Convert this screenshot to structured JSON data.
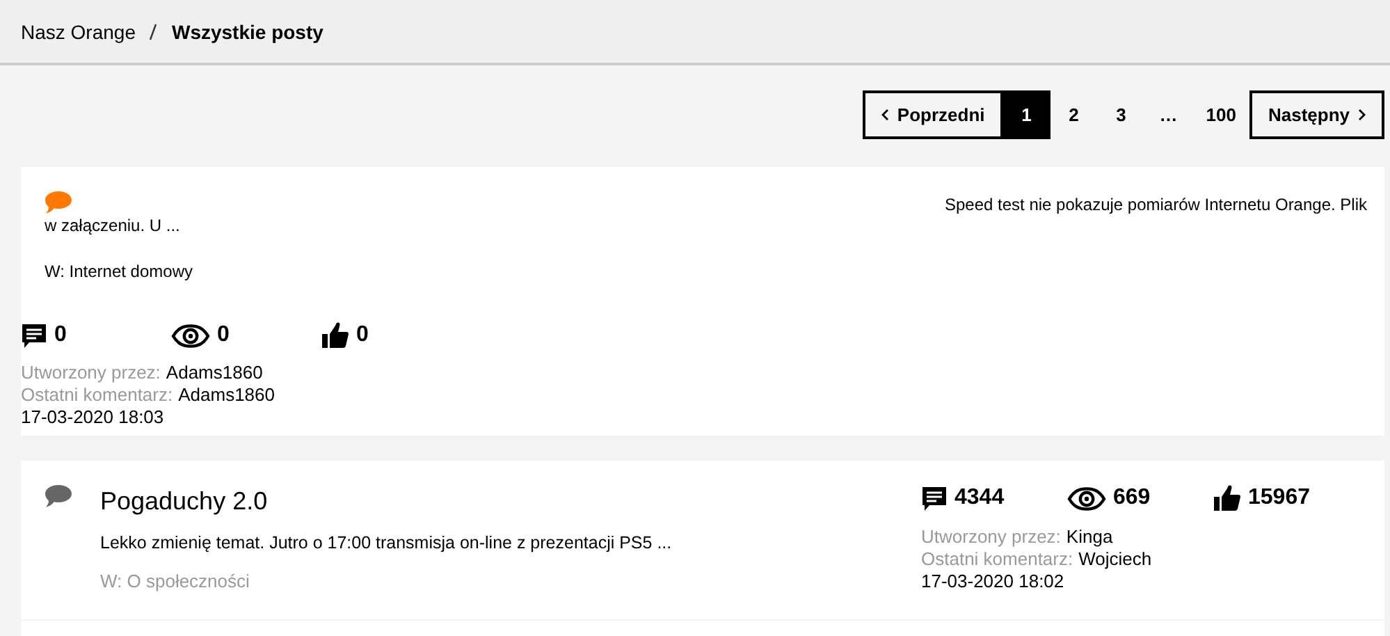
{
  "breadcrumb": [
    {
      "label": "Nasz Orange",
      "current": false
    },
    {
      "label": "Wszystkie posty",
      "current": true
    }
  ],
  "pagination": {
    "previous": "Poprzedni",
    "next": "Następny",
    "pages": [
      {
        "label": "1",
        "selected": true
      },
      {
        "label": "2",
        "selected": false
      },
      {
        "label": "3",
        "selected": false
      },
      {
        "label": "…",
        "selected": false
      },
      {
        "label": "100",
        "selected": false
      }
    ]
  },
  "posts": [
    {
      "kind": "stacked",
      "color": "#ff7900",
      "excerpt_lines": [
        "Speed test nie pokazuje pomiarów Internetu Orange. Plik",
        "w załączeniu. U ..."
      ],
      "category": "W: Internet domowy",
      "comments": "0",
      "views": "0",
      "likes": "0",
      "created_label": "Utworzony przez:",
      "author": "Adams1860",
      "last_label": "Ostatni komentarz:",
      "last_author": "Adams1860",
      "date": "17-03-2020 18:03"
    },
    {
      "kind": "columns",
      "color": "#666666",
      "title": "Pogaduchy 2.0",
      "excerpt_lines": [
        "Lekko zmienię temat. Jutro o 17:00 transmisja on-line z prezentacji PS5 ..."
      ],
      "category": "W: O społeczności",
      "comments": "4344",
      "views": "669",
      "likes": "15967",
      "created_label": "Utworzony przez:",
      "author": "Kinga",
      "last_label": "Ostatni komentarz:",
      "last_author": "Wojciech",
      "date": "17-03-2020 18:02"
    }
  ]
}
